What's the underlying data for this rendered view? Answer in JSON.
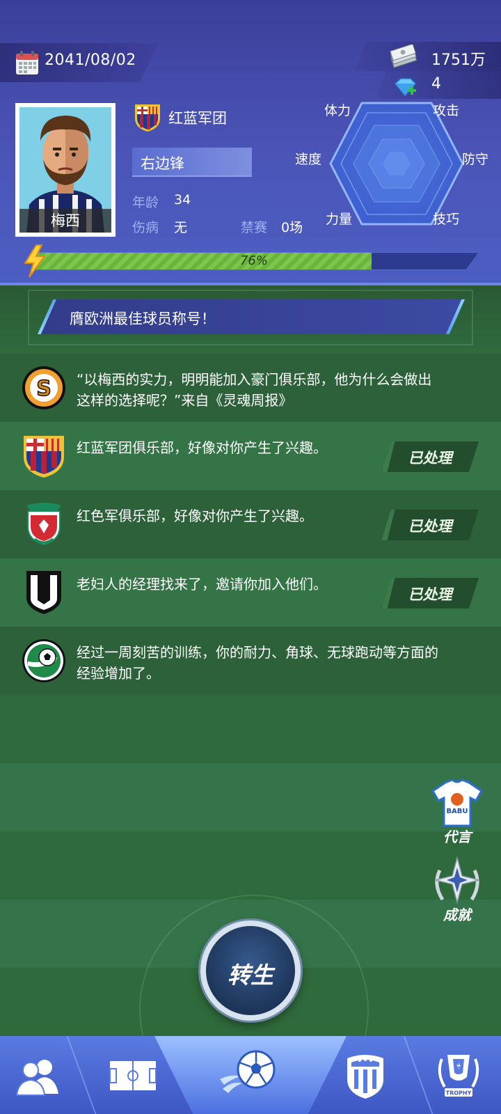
{
  "header": {
    "date": "2041/08/02",
    "money": "1751万",
    "gems": "4"
  },
  "player": {
    "name": "梅西",
    "club": "红蓝军团",
    "position": "右边锋",
    "age_label": "年龄",
    "age": "34",
    "injury_label": "伤病",
    "injury": "无",
    "ban_label": "禁赛",
    "ban": "0场"
  },
  "stats": {
    "stamina": "体力",
    "attack": "攻击",
    "speed": "速度",
    "defense": "防守",
    "strength": "力量",
    "skill": "技巧"
  },
  "energy": {
    "text": "76%",
    "value": 0.76
  },
  "banner": {
    "text": "膺欧洲最佳球员称号！"
  },
  "news": [
    {
      "text": "“以梅西的实力，明明能加入豪门俱乐部，他为什么会做出这样的选择呢？”来自《灵魂周报》",
      "icon": "soul-weekly-logo-icon"
    },
    {
      "text": "红蓝军团俱乐部，好像对你产生了兴趣。",
      "status": "已处理",
      "icon": "red-blue-club-badge-icon"
    },
    {
      "text": "红色军俱乐部，好像对你产生了兴趣。",
      "status": "已处理",
      "icon": "red-army-club-badge-icon"
    },
    {
      "text": "老妇人的经理找来了，邀请你加入他们。",
      "status": "已处理",
      "icon": "old-lady-club-badge-icon"
    },
    {
      "text": "经过一周刻苦的训练，你的耐力、角球、无球跑动等方面的经验增加了。",
      "icon": "training-ball-icon"
    }
  ],
  "side": {
    "endorse": "代言",
    "endorse_jersey": "BABU",
    "achievement": "成就"
  },
  "rebirth": "转生",
  "nav": {
    "trophy": "TROPHY",
    "icons": [
      "team-icon",
      "pitch-icon",
      "match-ball-icon",
      "club-shield-icon",
      "trophy-icon"
    ]
  },
  "colors": {
    "header_blue": "#4b55b8",
    "field_green": "#2f6a3c",
    "energy_green": "#7bc64b",
    "nav_blue": "#5a7be2"
  }
}
